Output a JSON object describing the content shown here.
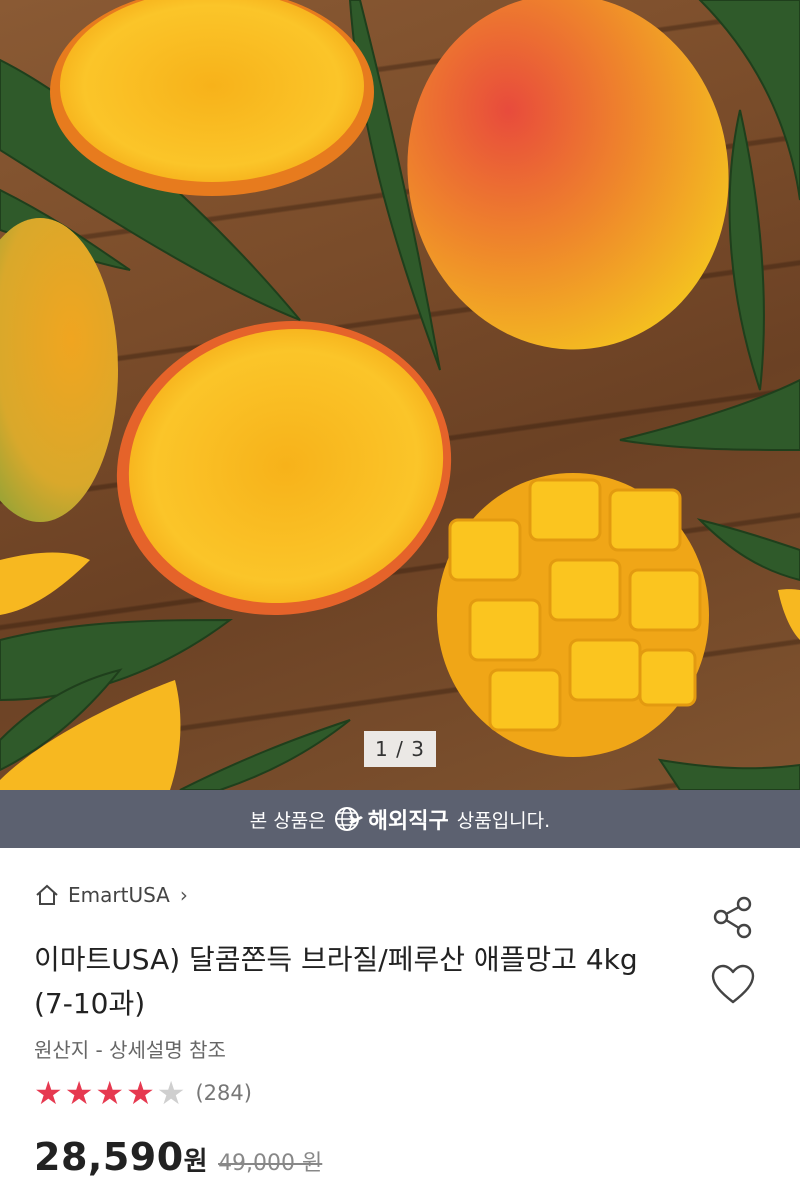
{
  "image": {
    "alt": "",
    "counter": "1 / 3"
  },
  "banner": {
    "prefix": "본 상품은",
    "brand": "해외직구",
    "suffix": "상품입니다.",
    "icon": "globe-plane-icon"
  },
  "seller": {
    "name": "EmartUSA",
    "icon": "home-icon",
    "chevron": "›"
  },
  "product": {
    "title": "이마트USA) 달콤쫀득 브라질/페루산 애플망고 4kg (7-10과)",
    "origin": "원산지 - 상세설명 참조",
    "rating": 4,
    "max_rating": 5,
    "review_count": "(284)",
    "price": "28,590",
    "price_unit": "원",
    "original_price": "49,000 원"
  },
  "actions": {
    "share_icon": "share-icon",
    "like_icon": "heart-icon"
  },
  "colors": {
    "banner_bg": "#5c6170",
    "star_filled": "#e63950",
    "star_empty": "#cfcfcf"
  }
}
